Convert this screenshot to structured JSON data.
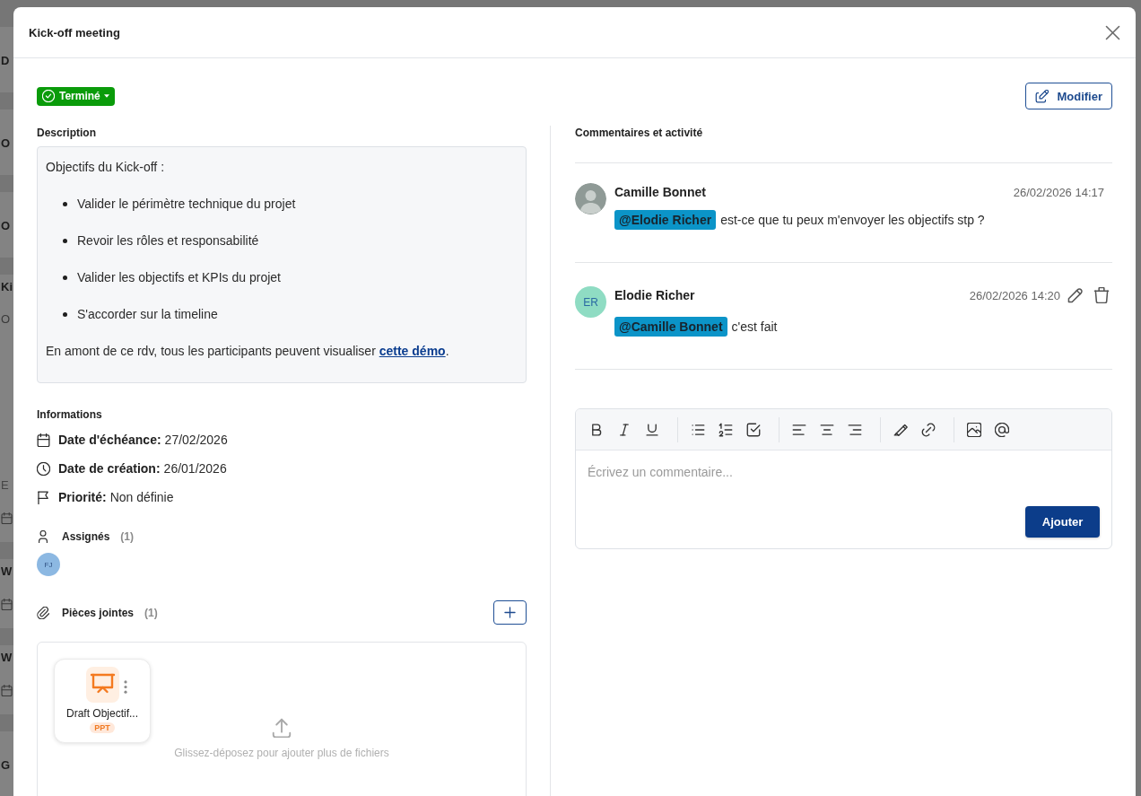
{
  "backdrop": {
    "cards": [
      {
        "lines": [
          {
            "kind": "title",
            "text": "D"
          }
        ]
      },
      {
        "lines": [
          {
            "kind": "title",
            "text": "O"
          }
        ]
      },
      {
        "lines": [
          {
            "kind": "title",
            "text": "O"
          }
        ]
      },
      {
        "lines": [
          {
            "kind": "title",
            "text": "Ki"
          },
          {
            "kind": "subtitle",
            "text": "O"
          },
          {
            "kind": "meta",
            "text": "E"
          },
          {
            "kind": "date"
          }
        ]
      },
      {
        "lines": [
          {
            "kind": "title",
            "text": "W"
          },
          {
            "kind": "date"
          }
        ]
      },
      {
        "lines": [
          {
            "kind": "title",
            "text": "W"
          },
          {
            "kind": "date"
          }
        ]
      },
      {
        "lines": [
          {
            "kind": "title",
            "text": "G"
          }
        ]
      }
    ]
  },
  "modal": {
    "title": "Kick-off meeting",
    "status": {
      "label": "Terminé"
    },
    "edit_button": {
      "label": "Modifier"
    },
    "description": {
      "heading": "Description",
      "blocks": [
        {
          "kind": "paragraph",
          "runs": [
            {
              "kind": "text",
              "text": "Objectifs du Kick-off :"
            }
          ]
        },
        {
          "kind": "bullets",
          "items": [
            "Valider le périmètre technique du projet",
            "Revoir les rôles et responsabilité",
            "Valider les objectifs et KPIs du projet",
            "S'accorder sur la timeline"
          ]
        },
        {
          "kind": "paragraph",
          "runs": [
            {
              "kind": "text",
              "text": "En amont de ce rdv, tous les participants peuvent visualiser "
            },
            {
              "kind": "link",
              "text": "cette démo"
            },
            {
              "kind": "text",
              "text": "."
            }
          ]
        }
      ]
    },
    "informations": {
      "heading": "Informations",
      "rows": [
        {
          "kind": "due",
          "label": "Date d'échéance:",
          "value": "27/02/2026"
        },
        {
          "kind": "created",
          "label": "Date de création:",
          "value": "26/01/2026"
        },
        {
          "kind": "priority",
          "label": "Priorité:",
          "value": "Non définie"
        }
      ]
    },
    "assignees": {
      "heading": "Assignés",
      "count": "(1)",
      "people": [
        {
          "initials": "FJ",
          "color": "#8cb8e2"
        }
      ]
    },
    "attachments": {
      "heading": "Pièces jointes",
      "count": "(1)",
      "files": [
        {
          "name": "Draft Objectif...",
          "type": "PPT"
        }
      ],
      "drop_hint": "Glissez-déposez pour ajouter plus de fichiers"
    },
    "comments": {
      "heading": "Commentaires et activité",
      "items": [
        {
          "author": "Camille Bonnet",
          "avatar": {
            "kind": "photo"
          },
          "time": "26/02/2026 14:17",
          "mention": "@Elodie Richer",
          "text": "est-ce que tu peux m'envoyer les objectifs stp ?",
          "editable": false
        },
        {
          "author": "Elodie Richer",
          "avatar": {
            "kind": "initials",
            "initials": "ER",
            "color": "#8fdcc3"
          },
          "time": "26/02/2026 14:20",
          "mention": "@Camille Bonnet",
          "text": "c'est fait",
          "editable": true
        }
      ]
    },
    "editor": {
      "toolbar": [
        [
          {
            "kind": "bold"
          },
          {
            "kind": "italic"
          },
          {
            "kind": "underline"
          }
        ],
        [
          {
            "kind": "bullet_list"
          },
          {
            "kind": "numbered_list"
          },
          {
            "kind": "checklist"
          }
        ],
        [
          {
            "kind": "align_left"
          },
          {
            "kind": "align_center"
          },
          {
            "kind": "align_right"
          }
        ],
        [
          {
            "kind": "highlight"
          },
          {
            "kind": "link"
          }
        ],
        [
          {
            "kind": "image"
          },
          {
            "kind": "mention"
          }
        ]
      ],
      "placeholder": "Écrivez un commentaire...",
      "submit": "Ajouter"
    }
  }
}
